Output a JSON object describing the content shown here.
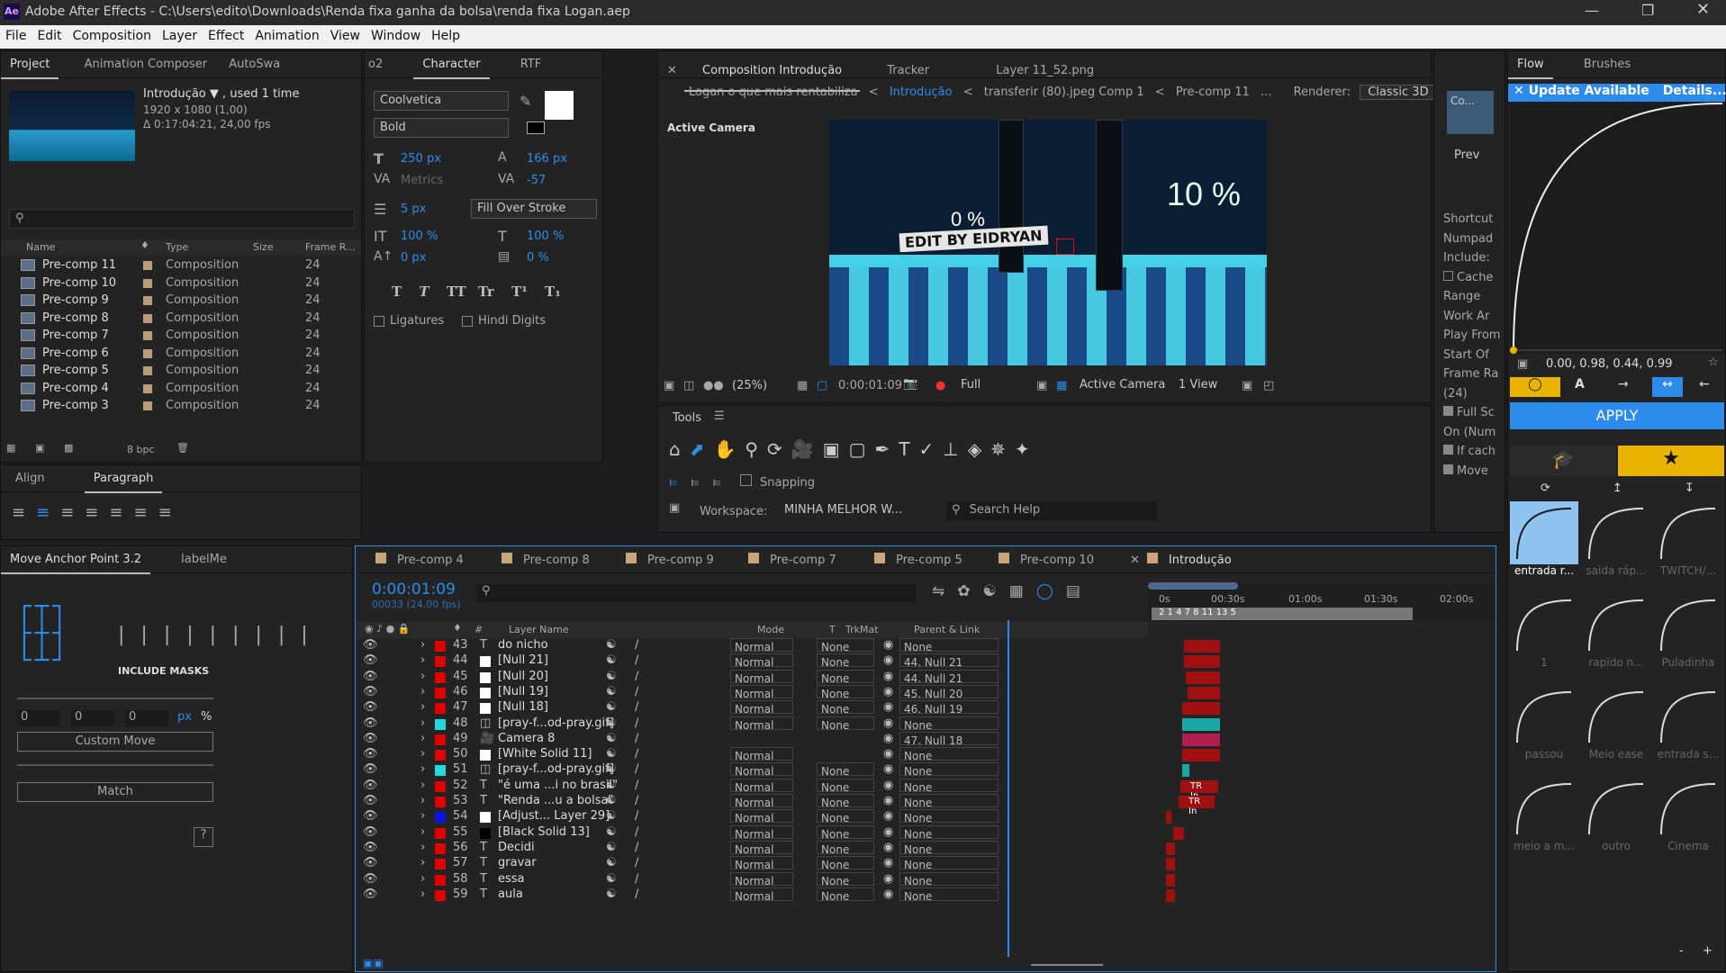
{
  "app": {
    "title": "Adobe After Effects - C:\\Users\\edito\\Downloads\\Renda fixa ganha da bolsa\\renda fixa Logan.aep",
    "logo": "Ae"
  },
  "menu": [
    "File",
    "Edit",
    "Composition",
    "Layer",
    "Effect",
    "Animation",
    "View",
    "Window",
    "Help"
  ],
  "project": {
    "tabs": [
      "Project",
      "Animation Composer",
      "AutoSwa"
    ],
    "comp_name": "Introdução ▼ , used 1 time",
    "comp_res": "1920 x 1080 (1,00)",
    "comp_dur": "Δ 0:17:04:21, 24,00 fps",
    "columns": [
      "Name",
      "Type",
      "Size",
      "Frame R..."
    ],
    "items": [
      {
        "name": "Pre-comp 11",
        "type": "Composition",
        "fps": "24"
      },
      {
        "name": "Pre-comp 10",
        "type": "Composition",
        "fps": "24"
      },
      {
        "name": "Pre-comp 9",
        "type": "Composition",
        "fps": "24"
      },
      {
        "name": "Pre-comp 8",
        "type": "Composition",
        "fps": "24"
      },
      {
        "name": "Pre-comp 7",
        "type": "Composition",
        "fps": "24"
      },
      {
        "name": "Pre-comp 6",
        "type": "Composition",
        "fps": "24"
      },
      {
        "name": "Pre-comp 5",
        "type": "Composition",
        "fps": "24"
      },
      {
        "name": "Pre-comp 4",
        "type": "Composition",
        "fps": "24"
      },
      {
        "name": "Pre-comp 3",
        "type": "Composition",
        "fps": "24"
      }
    ],
    "bpc": "8 bpc"
  },
  "character": {
    "tabs": [
      "o2",
      "Character",
      "RTF"
    ],
    "font": "Coolvetica",
    "style": "Bold",
    "size": "250 px",
    "leading": "166 px",
    "kerning": "Metrics",
    "tracking": "-57",
    "stroke": "5 px",
    "stroke_mode": "Fill Over Stroke",
    "vscale": "100 %",
    "hscale": "100 %",
    "baseline": "0 px",
    "tsume": "0 %",
    "styles": [
      "T",
      "T",
      "TT",
      "Tr",
      "T¹",
      "T₁"
    ],
    "ligatures": "Ligatures",
    "hindi": "Hindi Digits"
  },
  "paragraph": {
    "tabs": [
      "Align",
      "Paragraph"
    ]
  },
  "anchor": {
    "tabs": [
      "Move Anchor Point 3.2",
      "labelMe"
    ],
    "include_masks": "INCLUDE MASKS",
    "x": "0",
    "y": "0",
    "z": "0",
    "unit_px": "px",
    "unit_pct": "%",
    "custom_move": "Custom Move",
    "match": "Match",
    "help": "?"
  },
  "composition": {
    "tabs": [
      "Composition Introdução",
      "Tracker",
      "Layer 11_52.png"
    ],
    "breadcrumbs": [
      "Logan o que mais rentabiliza",
      "Introdução",
      "transferir (80).jpeg Comp 1",
      "Pre-comp 11",
      "..."
    ],
    "renderer_label": "Renderer:",
    "renderer": "Classic 3D",
    "active_camera": "Active Camera",
    "zoom": "(25%)",
    "timecode": "0:00:01:09",
    "quality": "Full",
    "camera": "Active Camera",
    "views": "1 View",
    "viewer_text": {
      "left_pct": "0 %",
      "right_pct": "10 %",
      "banner": "EDIT BY EIDRYAN"
    }
  },
  "tools": {
    "label": "Tools",
    "snapping": "Snapping",
    "workspace_label": "Workspace:",
    "workspace": "MINHA MELHOR W...",
    "search": "Search Help"
  },
  "preview": {
    "tab": "Co...",
    "prev": "Prev",
    "labels": [
      "Shortcut",
      "Numpad",
      "Include:",
      "Cache",
      "Range",
      "Work Ar",
      "Play From",
      "Start Of",
      "Frame Ra",
      "(24)",
      "Full Sc",
      "On (Num",
      "If cach",
      "Move"
    ]
  },
  "flow": {
    "tabs": [
      "Flow",
      "Brushes"
    ],
    "update": "Update Available",
    "details": "Details...",
    "values": "0.00, 0.98, 0.44, 0.99",
    "apply": "APPLY",
    "presets": [
      {
        "name": "entrada r..."
      },
      {
        "name": "saida ráp..."
      },
      {
        "name": "TWITCH/..."
      },
      {
        "name": "1"
      },
      {
        "name": "rapido n..."
      },
      {
        "name": "Puladinha"
      },
      {
        "name": "passou"
      },
      {
        "name": "Meio ease"
      },
      {
        "name": "entrada s..."
      },
      {
        "name": "meio a m..."
      },
      {
        "name": "outro"
      },
      {
        "name": "Cinema"
      }
    ],
    "zoom_minus": "-",
    "zoom_plus": "+"
  },
  "timeline": {
    "tabs": [
      "Pre-comp 4",
      "Pre-comp 8",
      "Pre-comp 9",
      "Pre-comp 7",
      "Pre-comp 5",
      "Pre-comp 10",
      "Introdução"
    ],
    "timecode": "0:00:01:09",
    "frames": "00033 (24.00 fps)",
    "ruler": [
      "0s",
      "00:30s",
      "01:00s",
      "01:30s",
      "02:00s"
    ],
    "columns": {
      "num": "#",
      "name": "Layer Name",
      "mode": "Mode",
      "t": "T",
      "trkmat": "TrkMat",
      "parent": "Parent & Link"
    },
    "layers": [
      {
        "n": "43",
        "color": "#e00000",
        "kind": "T",
        "name": "do nicho",
        "mode": "Normal",
        "trk": "None",
        "parent": "None"
      },
      {
        "n": "44",
        "color": "#e00000",
        "kind": "W",
        "name": "[Null 21]",
        "mode": "Normal",
        "trk": "None",
        "parent": "44. Null 21"
      },
      {
        "n": "45",
        "color": "#e00000",
        "kind": "W",
        "name": "[Null 20]",
        "mode": "Normal",
        "trk": "None",
        "parent": "44. Null 21"
      },
      {
        "n": "46",
        "color": "#e00000",
        "kind": "W",
        "name": "[Null 19]",
        "mode": "Normal",
        "trk": "None",
        "parent": "45. Null 20"
      },
      {
        "n": "47",
        "color": "#e00000",
        "kind": "W",
        "name": "[Null 18]",
        "mode": "Normal",
        "trk": "None",
        "parent": "46. Null 19"
      },
      {
        "n": "48",
        "color": "#22d8d8",
        "kind": "F",
        "name": "[pray-f...od-pray.gif]",
        "mode": "Normal",
        "trk": "None",
        "parent": "None"
      },
      {
        "n": "49",
        "color": "#e00000",
        "kind": "C",
        "name": "Camera 8",
        "mode": "",
        "trk": "",
        "parent": "47. Null 18"
      },
      {
        "n": "50",
        "color": "#e00000",
        "kind": "W",
        "name": "[White Solid 11]",
        "mode": "Normal",
        "trk": "",
        "parent": "None"
      },
      {
        "n": "51",
        "color": "#22d8d8",
        "kind": "F",
        "name": "[pray-f...od-pray.gif]",
        "mode": "Normal",
        "trk": "None",
        "parent": "None"
      },
      {
        "n": "52",
        "color": "#e00000",
        "kind": "T",
        "name": "\"é uma ...i no brasil\"",
        "mode": "Normal",
        "trk": "None",
        "parent": "None"
      },
      {
        "n": "53",
        "color": "#e00000",
        "kind": "T",
        "name": "\"Renda ...u a bolsa\"",
        "mode": "Normal",
        "trk": "None",
        "parent": "None"
      },
      {
        "n": "54",
        "color": "#1010e0",
        "kind": "W",
        "name": "[Adjust... Layer 29]",
        "mode": "Normal",
        "trk": "None",
        "parent": "None"
      },
      {
        "n": "55",
        "color": "#e00000",
        "kind": "K",
        "name": "[Black Solid 13]",
        "mode": "Normal",
        "trk": "None",
        "parent": "None"
      },
      {
        "n": "56",
        "color": "#e00000",
        "kind": "T",
        "name": "Decidi",
        "mode": "Normal",
        "trk": "None",
        "parent": "None"
      },
      {
        "n": "57",
        "color": "#e00000",
        "kind": "T",
        "name": "gravar",
        "mode": "Normal",
        "trk": "None",
        "parent": "None"
      },
      {
        "n": "58",
        "color": "#e00000",
        "kind": "T",
        "name": "essa",
        "mode": "Normal",
        "trk": "None",
        "parent": "None"
      },
      {
        "n": "59",
        "color": "#e00000",
        "kind": "T",
        "name": "aula",
        "mode": "Normal",
        "trk": "None",
        "parent": "None"
      }
    ],
    "tr_in": "TR In",
    "markers": "2 1 4 7 8 11 13 5"
  }
}
